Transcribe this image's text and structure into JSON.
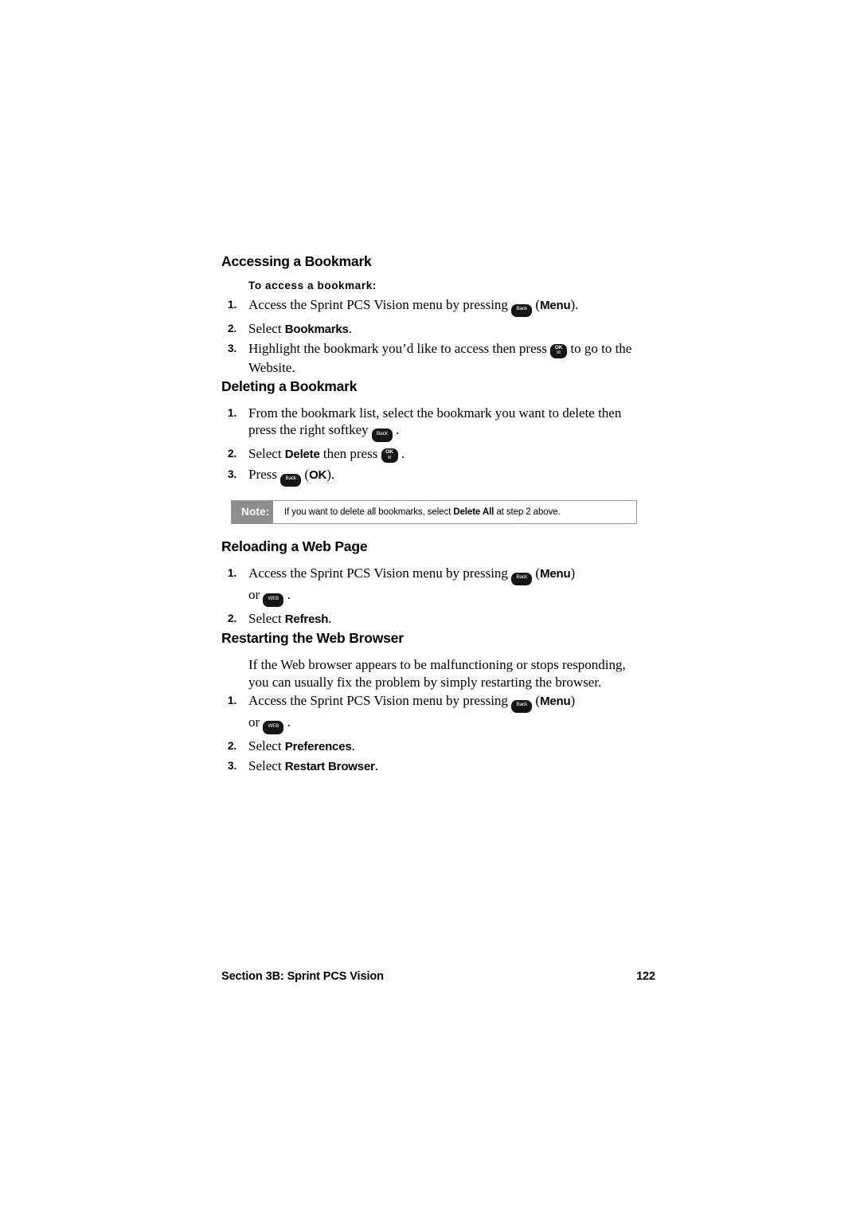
{
  "page": {
    "footer_section": "Section 3B: Sprint PCS Vision",
    "footer_page": "122"
  },
  "sections": [
    {
      "heading": "Accessing a Bookmark",
      "subhead": "To access a bookmark:",
      "steps": [
        {
          "num": "1.",
          "parts": [
            "Access the Sprint PCS Vision menu by pressing ",
            "KEY_BACK",
            " (",
            "Menu",
            ")."
          ]
        },
        {
          "num": "2.",
          "parts": [
            "Select ",
            "Bookmarks",
            "."
          ]
        },
        {
          "num": "3.",
          "parts": [
            "Highlight the bookmark you'd like to access then press ",
            "KEY_OK",
            " to go to the Website."
          ]
        }
      ]
    },
    {
      "heading": "Deleting a Bookmark",
      "steps": [
        {
          "num": "1.",
          "parts": [
            "From the bookmark list, select the bookmark you want to delete then press the right softkey ",
            "KEY_BACK",
            " ."
          ]
        },
        {
          "num": "2.",
          "parts": [
            "Select ",
            "Delete",
            " then press ",
            "KEY_OK",
            " ."
          ]
        },
        {
          "num": "3.",
          "parts": [
            "Press ",
            "KEY_BACK",
            " (",
            "OK",
            ")."
          ]
        }
      ]
    },
    {
      "heading": "Reloading a Web Page",
      "steps": [
        {
          "num": "1.",
          "parts": [
            "Access the Sprint PCS Vision menu by pressing ",
            "KEY_BACK",
            " (",
            "Menu",
            ") or ",
            "KEY_WEB",
            " ."
          ]
        },
        {
          "num": "2.",
          "parts": [
            "Select ",
            "Refresh",
            "."
          ]
        }
      ]
    },
    {
      "heading": "Restarting the Web Browser",
      "paragraph": "If the Web browser appears to be malfunctioning or stops responding, you can usually fix the problem by simply restarting the browser.",
      "steps": [
        {
          "num": "1.",
          "parts": [
            "Access the Sprint PCS Vision menu by pressing ",
            "KEY_BACK",
            " (",
            "Menu",
            ") or ",
            "KEY_WEB",
            " ."
          ]
        },
        {
          "num": "2.",
          "parts": [
            "Select ",
            "Preferences",
            "."
          ]
        },
        {
          "num": "3.",
          "parts": [
            "Select ",
            "Restart Browser",
            "."
          ]
        }
      ]
    }
  ],
  "note": {
    "label": "Note:",
    "text_before": "If you want to delete all bookmarks, select ",
    "text_bold": "Delete All",
    "text_after": " at step 2 above."
  },
  "text": {
    "h1": "Accessing a Bookmark",
    "sub1": "To access a bookmark:",
    "s1_1a": "Access the Sprint PCS Vision menu by pressing",
    "s1_1b": "(",
    "s1_1c": "Menu",
    "s1_1d": ").",
    "s1_2a": "Select",
    "s1_2b": "Bookmarks",
    "s1_2c": ".",
    "s1_3a": "Highlight the bookmark you’d like to access then press",
    "s1_3b": "to go to the Website.",
    "h2": "Deleting a Bookmark",
    "s2_1a": "From the bookmark list, select the bookmark you want to delete then press the right softkey",
    "s2_1b": ".",
    "s2_2a": "Select",
    "s2_2b": "Delete",
    "s2_2c": "then press",
    "s2_2d": ".",
    "s2_3a": "Press",
    "s2_3b": "(",
    "s2_3c": "OK",
    "s2_3d": ").",
    "h3": "Reloading a Web Page",
    "s3_1a": "Access the Sprint PCS Vision menu by pressing",
    "s3_1b": "(",
    "s3_1c": "Menu",
    "s3_1d": ")",
    "s3_1e": "or",
    "s3_1f": ".",
    "s3_2a": "Select",
    "s3_2b": "Refresh",
    "s3_2c": ".",
    "h4": "Restarting the Web Browser",
    "p4": "If the Web browser appears to be malfunctioning or stops responding, you can usually fix the problem by simply restarting the browser.",
    "s4_1a": "Access the Sprint PCS Vision menu by pressing",
    "s4_1b": "(",
    "s4_1c": "Menu",
    "s4_1d": ")",
    "s4_1e": "or",
    "s4_1f": ".",
    "s4_2a": "Select",
    "s4_2b": "Preferences",
    "s4_2c": ".",
    "s4_3a": "Select",
    "s4_3b": "Restart Browser",
    "s4_3c": "."
  },
  "keys": {
    "back_label": "Back",
    "ok_label_top": "OK",
    "ok_label_bottom": "☒",
    "web_label": "WEB"
  },
  "numbers": {
    "one": "1.",
    "two": "2.",
    "three": "3."
  }
}
